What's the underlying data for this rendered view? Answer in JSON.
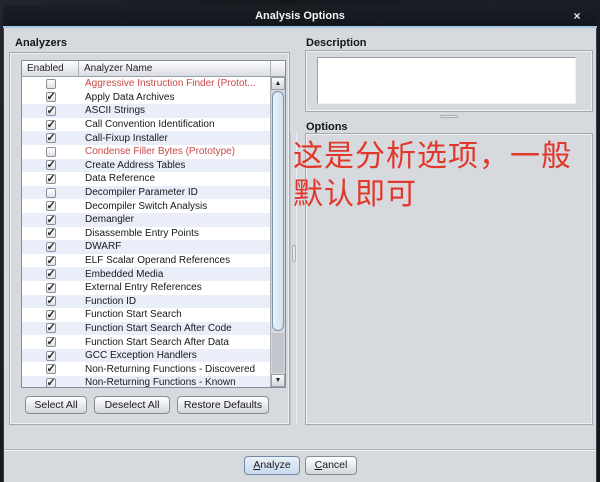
{
  "window": {
    "title": "Analysis Options",
    "close_label": "×"
  },
  "left_panel": {
    "title": "Analyzers",
    "table": {
      "columns": [
        "Enabled",
        "Analyzer Name"
      ],
      "rows": [
        {
          "name": "Aggressive Instruction Finder (Protot...",
          "enabled": false,
          "red": true
        },
        {
          "name": "Apply Data Archives",
          "enabled": true,
          "red": false
        },
        {
          "name": "ASCII Strings",
          "enabled": true,
          "red": false
        },
        {
          "name": "Call Convention Identification",
          "enabled": true,
          "red": false
        },
        {
          "name": "Call-Fixup Installer",
          "enabled": true,
          "red": false
        },
        {
          "name": "Condense Filler Bytes (Prototype)",
          "enabled": false,
          "red": true
        },
        {
          "name": "Create Address Tables",
          "enabled": true,
          "red": false
        },
        {
          "name": "Data Reference",
          "enabled": true,
          "red": false
        },
        {
          "name": "Decompiler Parameter ID",
          "enabled": false,
          "red": false
        },
        {
          "name": "Decompiler Switch Analysis",
          "enabled": true,
          "red": false
        },
        {
          "name": "Demangler",
          "enabled": true,
          "red": false
        },
        {
          "name": "Disassemble Entry Points",
          "enabled": true,
          "red": false
        },
        {
          "name": "DWARF",
          "enabled": true,
          "red": false
        },
        {
          "name": "ELF Scalar Operand References",
          "enabled": true,
          "red": false
        },
        {
          "name": "Embedded Media",
          "enabled": true,
          "red": false
        },
        {
          "name": "External Entry References",
          "enabled": true,
          "red": false
        },
        {
          "name": "Function ID",
          "enabled": true,
          "red": false
        },
        {
          "name": "Function Start Search",
          "enabled": true,
          "red": false
        },
        {
          "name": "Function Start Search After Code",
          "enabled": true,
          "red": false
        },
        {
          "name": "Function Start Search After Data",
          "enabled": true,
          "red": false
        },
        {
          "name": "GCC Exception Handlers",
          "enabled": true,
          "red": false
        },
        {
          "name": "Non-Returning Functions - Discovered",
          "enabled": true,
          "red": false
        },
        {
          "name": "Non-Returning Functions - Known",
          "enabled": true,
          "red": false
        }
      ]
    },
    "buttons": {
      "select_all": "Select All",
      "deselect_all": "Deselect All",
      "restore_defaults": "Restore Defaults"
    },
    "scrollbar": {
      "up_glyph": "▲",
      "down_glyph": "▼"
    }
  },
  "right_panel": {
    "description_title": "Description",
    "description_text": "",
    "options_title": "Options"
  },
  "annotation": {
    "text": "这是分析选项，一般默认即可",
    "color": "#e2372b"
  },
  "footer": {
    "analyze_label": "Analyze",
    "cancel_label": "Cancel"
  },
  "colors": {
    "titlebar_bg": "#15181e",
    "accent_line": "#a6c6e4",
    "dialog_bg": "#d6d9de",
    "row_stripe": "#e9eef8",
    "prototype_red": "#c84747",
    "annotation_red": "#e2372b"
  }
}
